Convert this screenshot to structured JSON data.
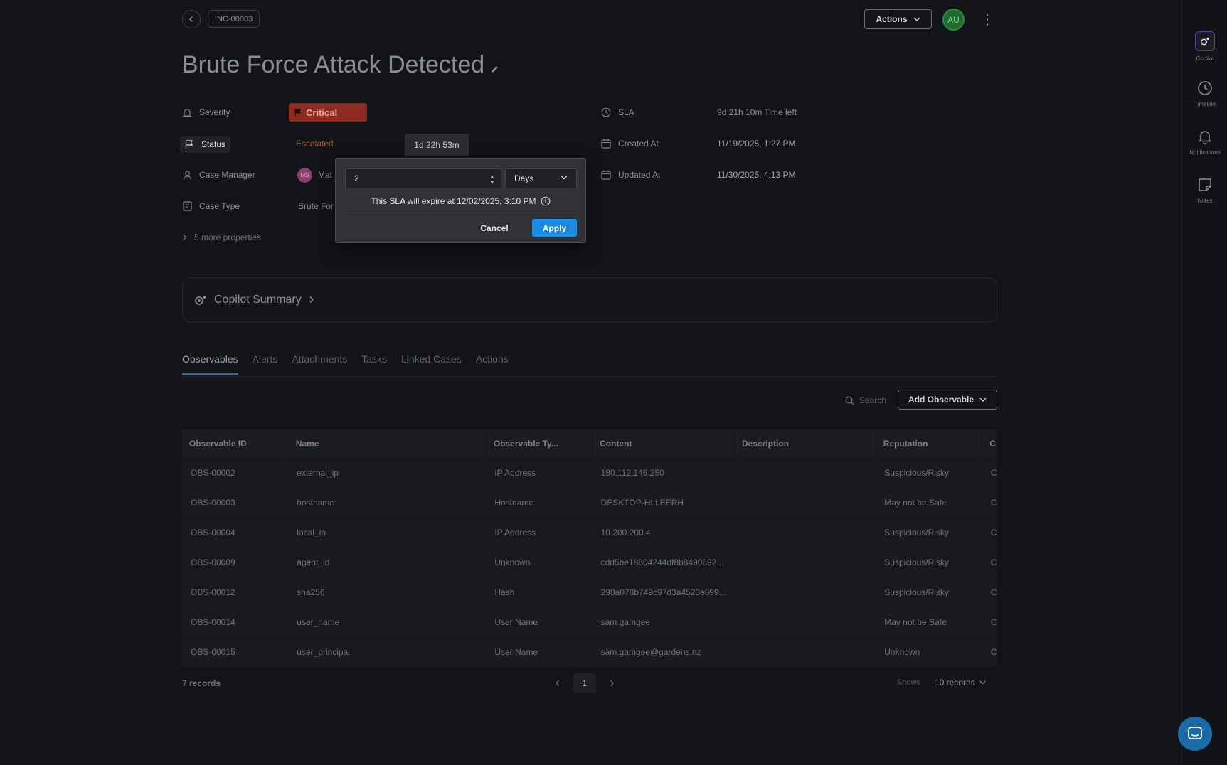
{
  "header": {
    "back_label": "‹",
    "case_id": "INC-00003",
    "actions_label": "Actions",
    "user_initials": "AU",
    "more_label": "⋮"
  },
  "case": {
    "title": "Brute Force Attack Detected",
    "properties_left": {
      "severity_label": "Severity",
      "severity_value": "Critical",
      "status_label": "Status",
      "status_value": "Escalated",
      "status_timer": "1d 22h 53m",
      "case_manager_label": "Case Manager",
      "case_manager_initials": "MS",
      "case_manager_name": "Mat",
      "case_type_label": "Case Type",
      "case_type_value": "Brute For",
      "more_properties": "5 more properties"
    },
    "properties_right": {
      "sla_label": "SLA",
      "sla_value": "9d 21h 10m  Time left",
      "created_label": "Created At",
      "created_value": "11/19/2025, 1:27 PM",
      "updated_label": "Updated At",
      "updated_value": "11/30/2025, 4:13 PM"
    }
  },
  "copilot_summary": {
    "title": "Copilot Summary"
  },
  "tabs": [
    {
      "label": "Observables",
      "active": true
    },
    {
      "label": "Alerts",
      "active": false
    },
    {
      "label": "Attachments",
      "active": false
    },
    {
      "label": "Tasks",
      "active": false
    },
    {
      "label": "Linked Cases",
      "active": false
    },
    {
      "label": "Actions",
      "active": false
    }
  ],
  "toolbar": {
    "search_placeholder": "Search",
    "add_observable_label": "Add Observable"
  },
  "table": {
    "columns": [
      "Observable ID",
      "Name",
      "Observable Ty...",
      "Content",
      "Description",
      "Reputation",
      "C"
    ],
    "rows": [
      [
        "OBS-00002",
        "external_ip",
        "IP Address",
        "180.112.146.250",
        "",
        "Suspicious/Risky",
        "C"
      ],
      [
        "OBS-00003",
        "hostname",
        "Hostname",
        "DESKTOP-HLLEERH",
        "",
        "May not be Safe",
        "C"
      ],
      [
        "OBS-00004",
        "local_ip",
        "IP Address",
        "10.200.200.4",
        "",
        "Suspicious/Risky",
        "C"
      ],
      [
        "OBS-00009",
        "agent_id",
        "Unknown",
        "cdd5be18804244df8b8490692...",
        "",
        "Suspicious/Risky",
        "C"
      ],
      [
        "OBS-00012",
        "sha256",
        "Hash",
        "298a078b749c97d3a4523e899...",
        "",
        "Suspicious/Risky",
        "C"
      ],
      [
        "OBS-00014",
        "user_name",
        "User Name",
        "sam.gamgee",
        "",
        "May not be Safe",
        "C"
      ],
      [
        "OBS-00015",
        "user_principal",
        "User Name",
        "sam.gamgee@gardens.nz",
        "",
        "Unknown",
        "C"
      ]
    ]
  },
  "footer": {
    "records_count": "7 records",
    "current_page": "1",
    "shows_label": "Shows",
    "per_page_value": "10 records"
  },
  "right_bar": {
    "copilot": "Copilot",
    "timeline": "Timeline",
    "notifications": "Notifications",
    "notes": "Notes"
  },
  "sla_popover": {
    "amount_value": "2",
    "unit_value": "Days",
    "expiry_note": "This SLA will expire at 12/02/2025, 3:10 PM",
    "cancel_label": "Cancel",
    "apply_label": "Apply"
  },
  "colors": {
    "accent": "#1a8be0",
    "critical": "#8e2a1f",
    "escalated": "#a9572f"
  }
}
